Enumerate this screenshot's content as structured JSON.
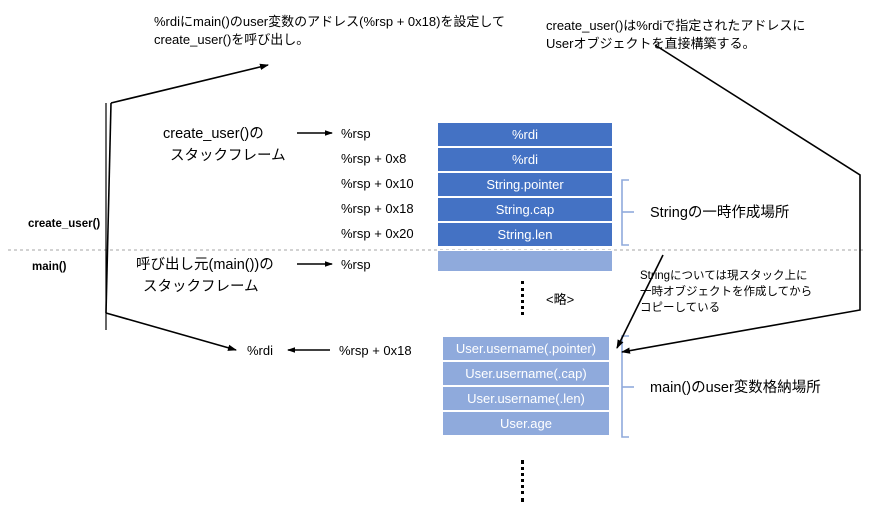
{
  "diagram": {
    "title_note_left": {
      "line1": "%rdiにmain()のuser変数のアドレス(%rsp + 0x18)を設定して",
      "line2": "create_user()を呼び出し。"
    },
    "title_note_right": {
      "line1": "create_user()は%rdiで指定されたアドレスに",
      "line2": "Userオブジェクトを直接構築する。"
    },
    "frames": {
      "upper_label_line1": "create_user()の",
      "upper_label_line2": "スタックフレーム",
      "lower_label_line1": "呼び出し元(main())の",
      "lower_label_line2": "スタックフレーム"
    },
    "side_labels": {
      "create_user": "create_user()",
      "main": "main()"
    },
    "addresses": {
      "rsp": "%rsp",
      "rsp_08": "%rsp + 0x8",
      "rsp_10": "%rsp + 0x10",
      "rsp_18": "%rsp + 0x18",
      "rsp_20": "%rsp + 0x20",
      "rsp_main": "%rsp",
      "rsp_18_lower": "%rsp + 0x18"
    },
    "registers": {
      "rdi": "%rdi"
    },
    "upper_stack_cells": [
      "%rdi",
      "%rdi",
      "String.pointer",
      "String.cap",
      "String.len"
    ],
    "upper_stack_blank_cell": "",
    "lower_stack_cells": [
      "User.username(.pointer)",
      "User.username(.cap)",
      "User.username(.len)",
      "User.age"
    ],
    "brackets": {
      "upper_bracket_label": "Stringの一時作成場所",
      "lower_bracket_label": "main()のuser変数格納場所"
    },
    "omission_marker": "<略>",
    "callout": {
      "line1": "Stringについては現スタック上に",
      "line2": "一時オブジェクトを作成してから",
      "line3": "コピーしている"
    },
    "colors": {
      "cell_dark": "#4472C4",
      "cell_light": "#8FAADC",
      "bracket": "#8FAADC",
      "line": "#000000",
      "divider": "#A6A6A6"
    }
  }
}
